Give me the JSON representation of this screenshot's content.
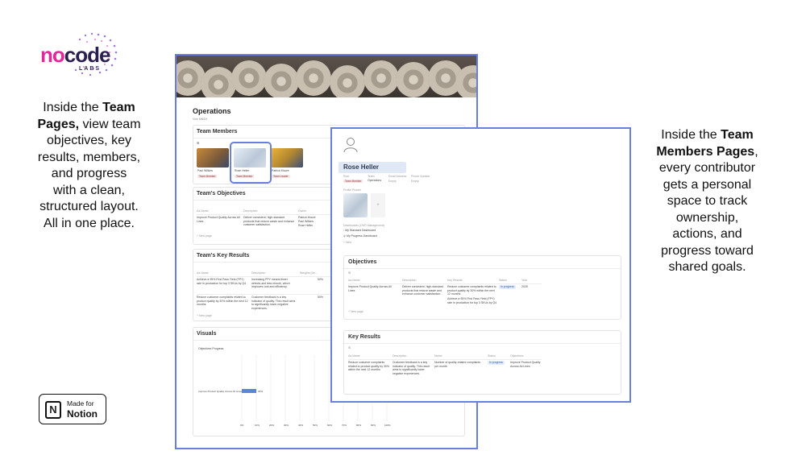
{
  "logo": {
    "no": "no",
    "code": "code",
    "labs": "LABS"
  },
  "left_caption": {
    "line1_pre": "Inside the ",
    "line1_bold": "Team",
    "line2_bold": "Pages,",
    "line2_post": " view team",
    "line3": "objectives, key",
    "line4": "results, members,",
    "line5": "and progress",
    "line6": "with a clean,",
    "line7": "structured layout.",
    "line8": "All in one place."
  },
  "right_caption": {
    "line1_pre": "Inside the ",
    "line1_bold": "Team",
    "line2_bold": "Members Pages",
    "line2_post": ",",
    "line3": "every contributor",
    "line4": "gets a personal",
    "line5": "space to track",
    "line6": "ownership,",
    "line7": "actions, and",
    "line8": "progress toward",
    "line9": "shared goals."
  },
  "badge": {
    "line1": "Made for",
    "line2": "Notion",
    "icon": "N"
  },
  "team_page": {
    "title": "Operations",
    "subtitle": "Vice MNSH",
    "members_title": "Team Members",
    "members": [
      {
        "name": "Paul Wilkins",
        "role": "Team Member"
      },
      {
        "name": "Rose Heller",
        "role": "Team Member"
      },
      {
        "name": "Patrick Moore",
        "role": "Team Leader"
      }
    ],
    "objectives_title": "Team's Objectives",
    "objectives_headers": [
      "Aa Name",
      "Description",
      "Owner"
    ],
    "objectives_rows": [
      {
        "name": "Improve Product Quality Across All Lines",
        "desc": "Deliver consistent, high-standard products that reduce waste and enhance customer satisfaction.",
        "owners": [
          "Patrick Moore",
          "Paul Wilkins",
          "Rose Heller"
        ]
      }
    ],
    "new_page": "+ New page",
    "key_results_title": "Team's Key Results",
    "kr_headers": [
      "Aa Name",
      "Description",
      "Weights (for..."
    ],
    "kr_rows": [
      {
        "name": "Achieve a 95% First Pass Yield (FPY) rate in production for top 3 SKUs by Q4",
        "desc": "Increasing FPY means fewer defects and less rework, which improves cost and efficiency.",
        "weight": "50%"
      },
      {
        "name": "Reduce customer complaints related to product quality by 30% within the next 12 months",
        "desc": "Customer feedback is a key indicator of quality. This result aims to significantly lower negative experiences.",
        "weight": "50%"
      }
    ],
    "visuals_title": "Visuals",
    "chart_label": "Objectives Progress",
    "chart_bar_label": "Improve Product Quality Across All Lines",
    "chart_bar_value": "30%",
    "chart_ticks": [
      "0%",
      "10%",
      "20%",
      "30%",
      "40%",
      "50%",
      "60%",
      "70%",
      "80%",
      "90%",
      "100%"
    ]
  },
  "member_page": {
    "name": "Rose Heller",
    "props": [
      "Role",
      "Team",
      "Email Address",
      "Phone Number"
    ],
    "role": "Team Member",
    "team": "Operations",
    "empty": "Empty",
    "profile_label": "Profile Picture",
    "dash_label": "Dashboards (OKR Management)",
    "dash_links": [
      "My Standard Dashboard",
      "My Progress Dashboard"
    ],
    "objectives_title": "Objectives",
    "obj_headers": [
      "Aa Name",
      "Description",
      "Key Results",
      "Status",
      "Year"
    ],
    "obj_row": {
      "name": "Improve Product Quality Across All Lines",
      "desc": "Deliver consistent, high-standard products that reduce waste and enhance customer satisfaction.",
      "kr1": "Reduce customer complaints related to product quality by 30% within the next 12 months",
      "kr2": "Achieve a 95% First Pass Yield (FPY) rate in production for top 3 SKUs by Q4",
      "status": "In progress",
      "year": "2025"
    },
    "key_results_title": "Key Results",
    "kr_headers": [
      "Aa Name",
      "Description",
      "Metric",
      "Status",
      "Objectives"
    ],
    "kr_row": {
      "name": "Reduce customer complaints related to product quality by 30% within the next 12 months",
      "desc": "Customer feedback is a key indicator of quality. This result aims to significantly lower negative experiences.",
      "metric": "Number of quality-related complaints per month",
      "status": "In progress",
      "objective": "Improve Product Quality Across All Lines"
    },
    "new_page": "+ New page"
  }
}
